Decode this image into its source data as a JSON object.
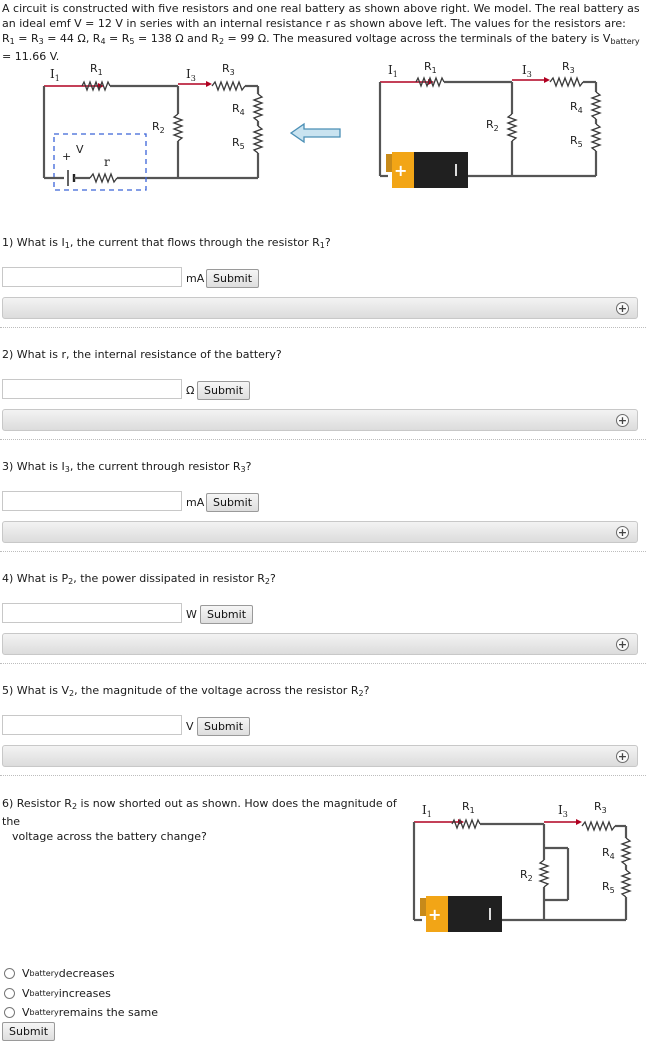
{
  "intro": {
    "p1": "A circuit is constructed with five resistors and one real battery as shown above right. We model. The real battery as an ideal emf V = 12 V in series with an internal resistance r as shown above left. The values for the resistors are: R",
    "p2": " = R",
    "p3": " = 44 Ω, R",
    "p4": " = R",
    "p5": " = 138 Ω and R",
    "p6": " = 99 Ω. The measured voltage across the terminals of the batery is V",
    "p7": " = 11.66 V.",
    "s1": "1",
    "s2": "3",
    "s3": "4",
    "s4": "5",
    "s5": "2",
    "s6": "battery"
  },
  "circuit_labels": {
    "I1": "I",
    "I1_sub": "1",
    "I3": "I",
    "I3_sub": "3",
    "R1": "R",
    "R1_sub": "1",
    "R2": "R",
    "R2_sub": "2",
    "R3": "R",
    "R3_sub": "3",
    "R4": "R",
    "R4_sub": "4",
    "R5": "R",
    "R5_sub": "5",
    "V": "V",
    "r": "r",
    "plus": "+",
    "minus": "-",
    "battery_plus": "+"
  },
  "questions": [
    {
      "num": "1) What is I",
      "sub": "1",
      "rest": ", the current that flows through the resistor R",
      "sub2": "1",
      "end": "?",
      "unit": "mA",
      "value": ""
    },
    {
      "num": "2) What is r, the internal resistance of the battery?",
      "sub": "",
      "rest": "",
      "sub2": "",
      "end": "",
      "unit": "Ω",
      "value": ""
    },
    {
      "num": "3) What is I",
      "sub": "3",
      "rest": ", the current through resistor R",
      "sub2": "3",
      "end": "?",
      "unit": "mA",
      "value": ""
    },
    {
      "num": "4) What is P",
      "sub": "2",
      "rest": ", the power dissipated in resistor R",
      "sub2": "2",
      "end": "?",
      "unit": "W",
      "value": ""
    },
    {
      "num": "5) What is V",
      "sub": "2",
      "rest": ", the magnitude of the voltage across the resistor R",
      "sub2": "2",
      "end": "?",
      "unit": "V",
      "value": ""
    }
  ],
  "submit_label": "Submit",
  "hint_icon": "+",
  "q6": {
    "line1a": "6) Resistor R",
    "line1sub": "2",
    "line1b": " is now shorted out as shown. How does the magnitude of the",
    "line2": "voltage across the battery change?",
    "options": [
      {
        "pre": "V",
        "sub": "battery",
        "post": " decreases"
      },
      {
        "pre": "V",
        "sub": "battery",
        "post": " increases"
      },
      {
        "pre": "V",
        "sub": "battery",
        "post": " remains the same"
      }
    ],
    "submit_label": "Submit"
  },
  "icons": {
    "arrow": "left-arrow-icon",
    "hint": "plus-circle-icon",
    "battery": "battery-icon"
  }
}
